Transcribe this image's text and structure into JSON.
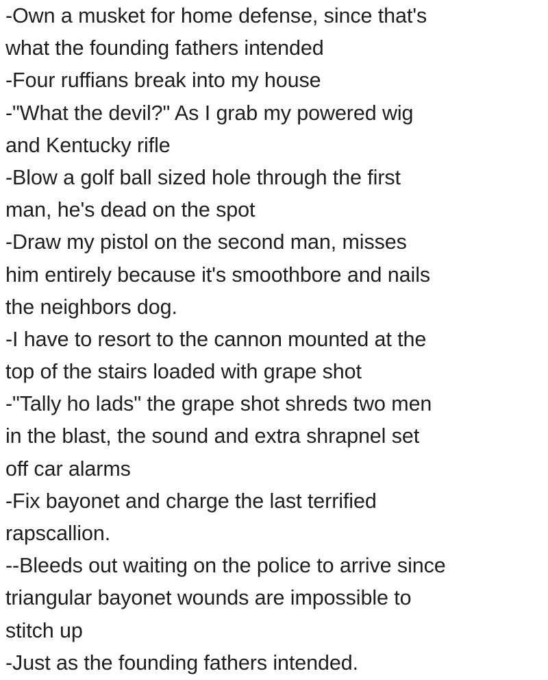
{
  "post": {
    "lines": [
      "-Own a musket for home defense, since that's",
      "what the founding fathers intended",
      "-Four ruffians break into my house",
      "-\"What the devil?\" As I grab my powered wig",
      "and Kentucky rifle",
      "-Blow a golf ball sized hole through the first",
      "man, he's dead on the spot",
      "-Draw my pistol on the second man, misses",
      "him entirely because it's smoothbore and nails",
      "the neighbors dog.",
      "-I have to resort to the cannon mounted at the",
      "top of the stairs loaded with grape shot",
      "-\"Tally ho lads\" the grape shot shreds two men",
      "in the blast, the sound and extra shrapnel set",
      "off car alarms",
      "-Fix bayonet and charge the last terrified",
      "rapscallion.",
      "--Bleeds out waiting on the police to arrive since",
      "triangular bayonet wounds are impossible to",
      "stitch up",
      "-Just as the founding fathers intended."
    ]
  }
}
